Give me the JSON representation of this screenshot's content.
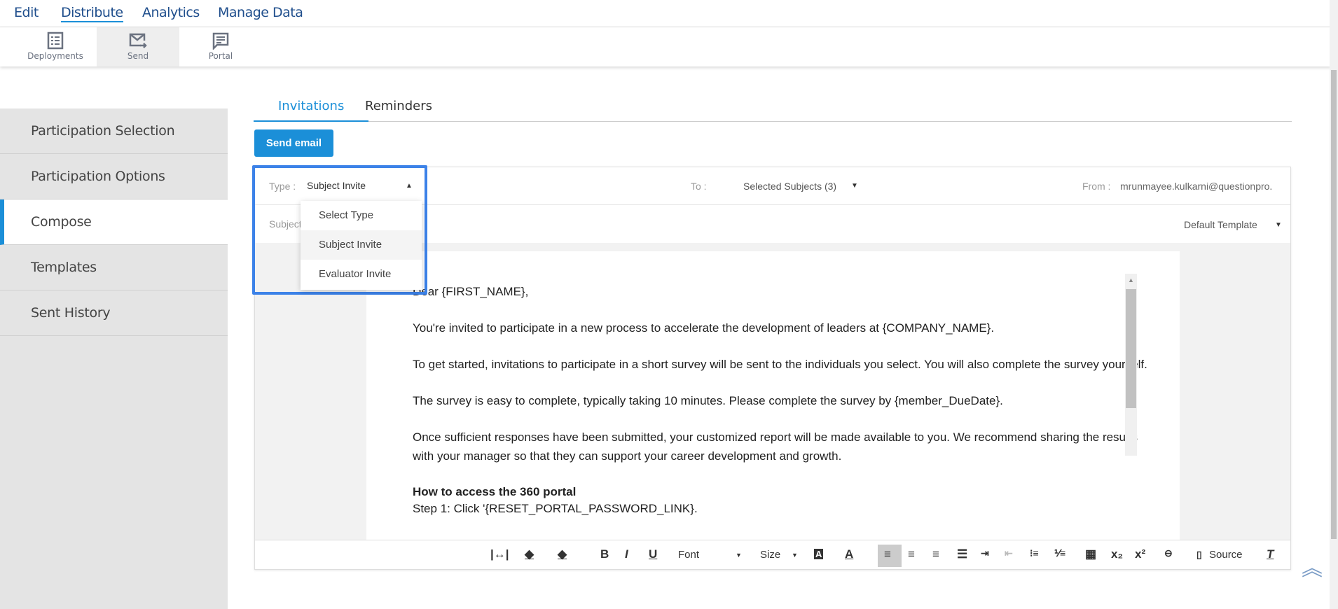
{
  "top_nav": [
    {
      "label": "Edit"
    },
    {
      "label": "Distribute",
      "active": true
    },
    {
      "label": "Analytics"
    },
    {
      "label": "Manage Data"
    }
  ],
  "sub_nav": [
    {
      "label": "Deployments",
      "icon": "list-icon"
    },
    {
      "label": "Send",
      "icon": "mail-send-icon",
      "active": true
    },
    {
      "label": "Portal",
      "icon": "chat-icon"
    }
  ],
  "sidebar": {
    "items": [
      {
        "label": "Participation Selection"
      },
      {
        "label": "Participation Options"
      },
      {
        "label": "Compose",
        "active": true
      },
      {
        "label": "Templates"
      },
      {
        "label": "Sent History"
      }
    ]
  },
  "tabs": [
    {
      "label": "Invitations",
      "active": true
    },
    {
      "label": "Reminders"
    }
  ],
  "send_button": "Send email",
  "compose": {
    "type_label": "Type :",
    "type_value": "Subject Invite",
    "to_label": "To :",
    "to_value": "Selected Subjects (3)",
    "from_label": "From :",
    "from_value": "mrunmayee.kulkarni@questionpro.",
    "subject_label": "Subject",
    "template_value": "Default Template",
    "type_options": [
      "Select Type",
      "Subject Invite",
      "Evaluator Invite"
    ]
  },
  "body_lines": [
    "Dear {FIRST_NAME},",
    "You're invited to participate in a new process to accelerate the development of leaders at {COMPANY_NAME}.",
    "To get started, invitations to participate in a short survey will be sent to the individuals you select. You will also complete the survey yourself.",
    "The survey is easy to complete, typically taking 10 minutes. Please complete the survey by {member_DueDate}.",
    "Once sufficient responses have been submitted, your customized report will be made available to you.  We recommend sharing the results",
    "with your manager so that they can support your career development and growth.",
    "How to access the 360 portal",
    "Step 1: Click '{RESET_PORTAL_PASSWORD_LINK}."
  ],
  "toolbar": {
    "font": "Font",
    "size": "Size",
    "source": "Source"
  },
  "colors": {
    "accent": "#1b8fd8",
    "highlight_box": "#3c82e8",
    "nav_text": "#1f4e8c"
  }
}
